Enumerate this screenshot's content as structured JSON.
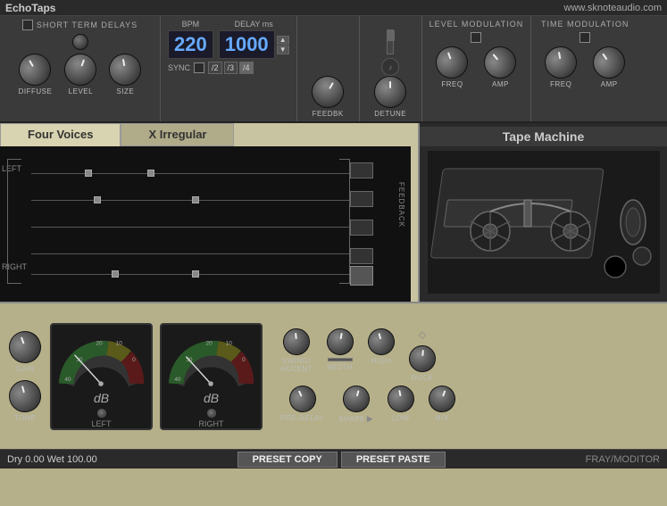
{
  "titleBar": {
    "title": "EchoTaps",
    "url": "www.sknoteaudio.com"
  },
  "topSection": {
    "shortTermDelays": {
      "label": "SHORT TERM DELAYS",
      "knobs": [
        {
          "id": "diffuse",
          "label": "DIFFUSE"
        },
        {
          "id": "level",
          "label": "LEVEL"
        },
        {
          "id": "size",
          "label": "SIZE"
        }
      ]
    },
    "bpm": {
      "label": "BPM",
      "value": "220"
    },
    "delay": {
      "label": "DELAY ms",
      "value": "1000"
    },
    "sync": {
      "label": "SYNC",
      "divisions": [
        "/2",
        "/3",
        "/4"
      ]
    },
    "feedbk": {
      "label": "FEEDBK"
    },
    "detune": {
      "label": "DETUNE"
    },
    "levelMod": {
      "label": "LEVEL MODULATION",
      "knobs": [
        {
          "id": "lm-freq",
          "label": "FREQ"
        },
        {
          "id": "lm-amp",
          "label": "AMP"
        }
      ]
    },
    "timeMod": {
      "label": "TIME MODULATION",
      "knobs": [
        {
          "id": "tm-freq",
          "label": "FREQ"
        },
        {
          "id": "tm-amp",
          "label": "AMP"
        }
      ]
    }
  },
  "tabs": {
    "active": "four-voices",
    "items": [
      {
        "id": "four-voices",
        "label": "Four Voices"
      },
      {
        "id": "x-irregular",
        "label": "X Irregular"
      }
    ]
  },
  "rightPanel": {
    "label": "Tape Machine"
  },
  "delayLines": {
    "leftLabel": "LEFT",
    "rightLabel": "RIGHT",
    "feedbackLabel": "FEEDBACK"
  },
  "bottomSection": {
    "gain": {
      "label": "GAIN"
    },
    "tone": {
      "label": "TONE"
    },
    "vuLeft": {
      "label": "dB",
      "channel": "LEFT"
    },
    "vuRight": {
      "label": "dB",
      "channel": "RIGHT"
    },
    "rightKnobs": {
      "row1": [
        {
          "id": "swing-accent",
          "label": "SWING/\nACCENT"
        },
        {
          "id": "width",
          "label": "WIDTH"
        },
        {
          "id": "high",
          "label": "HIGH"
        },
        {
          "id": "duck",
          "label": "DUCK"
        }
      ],
      "row2": [
        {
          "id": "pre-delay",
          "label": "PRE-DELAY"
        },
        {
          "id": "shape",
          "label": "SHAPE"
        },
        {
          "id": "low",
          "label": "LOW"
        },
        {
          "id": "mix",
          "label": "MIX"
        }
      ]
    }
  },
  "statusBar": {
    "statusText": "Dry 0.00  Wet 100.00",
    "presetCopy": "PRESET COPY",
    "presetPaste": "PRESET PASTE",
    "frayText": "FRAY/MODITOR"
  }
}
